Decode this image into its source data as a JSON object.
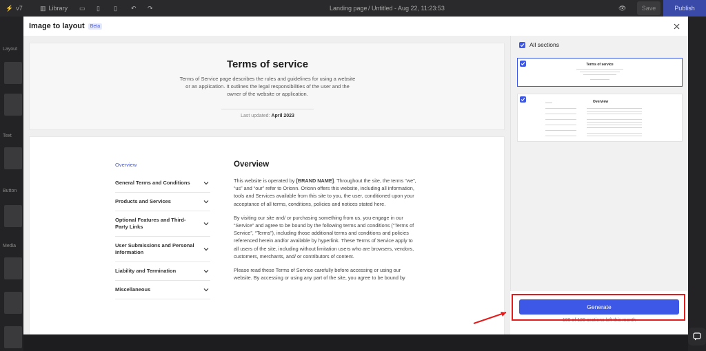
{
  "editor": {
    "version": "v7",
    "library": "Library",
    "page": "Landing page",
    "doc_status": "/ Untitled - Aug 22, 11:23:53",
    "preview": "Save",
    "publish": "Publish",
    "left_sections": [
      "Layout",
      "Text",
      "Button",
      "Media"
    ]
  },
  "modal": {
    "title": "Image to layout",
    "badge": "Beta",
    "close_icon": "close-icon"
  },
  "preview": {
    "hero": {
      "title": "Terms of service",
      "description": "Terms of Service page describes the rules and guidelines for using a website or an application. It outlines the legal responsibilities of the user and the owner of the website or application.",
      "updated_label": "Last updated:",
      "updated_date": "April 2023"
    },
    "toc": [
      {
        "label": "Overview",
        "active": true
      },
      {
        "label": "General Terms and Conditions"
      },
      {
        "label": "Products and Services"
      },
      {
        "label": "Optional Features and Third-Party Links"
      },
      {
        "label": "User Submissions and Personal Information"
      },
      {
        "label": "Liability and Termination"
      },
      {
        "label": "Miscellaneous"
      }
    ],
    "overview": {
      "title": "Overview",
      "p1_before": "This website is operated by ",
      "p1_brand": "[BRAND NAME]",
      "p1_after": ". Throughout the site, the terms “we”, “us” and “our” refer to Orionn. Orionn offers this website, including all information, tools and Services available from this site to you, the user, conditioned upon your acceptance of all terms, conditions, policies and notices stated here.",
      "p2": "By visiting our site and/ or purchasing something from us, you engage in our “Service” and agree to be bound by the following terms and conditions (“Terms of Service”, “Terms”), including those additional terms and conditions and policies referenced herein and/or available by hyperlink. These Terms of Service apply to all users of the site, including without limitation users who are browsers, vendors, customers, merchants, and/ or contributors of content.",
      "p3": "Please read these Terms of Service carefully before accessing or using our website. By accessing or using any part of the site, you agree to be bound by"
    }
  },
  "sections_panel": {
    "all_sections": "All sections",
    "thumb1_title": "Terms of service",
    "thumb2_title": "Overview",
    "generate": "Generate",
    "sections_left": "100 of 120 sections left this month"
  },
  "colors": {
    "accent": "#3d57e6",
    "annotation": "#e31b1b"
  }
}
